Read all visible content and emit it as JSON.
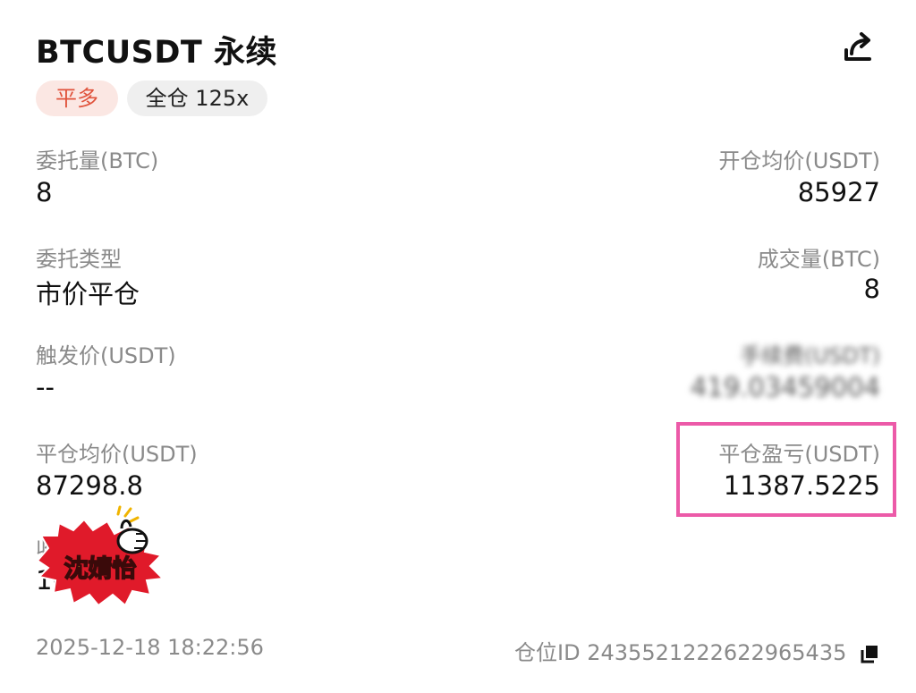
{
  "header": {
    "title": "BTCUSDT 永续",
    "tags": {
      "side": "平多",
      "margin": "全仓 125x"
    }
  },
  "fields": {
    "order_qty": {
      "label": "委托量(BTC)",
      "value": "8"
    },
    "open_avg": {
      "label": "开仓均价(USDT)",
      "value": "85927"
    },
    "order_type": {
      "label": "委托类型",
      "value": "市价平仓"
    },
    "filled_qty": {
      "label": "成交量(BTC)",
      "value": "8"
    },
    "trigger_price": {
      "label": "触发价(USDT)",
      "value": "--"
    },
    "fee": {
      "label": "手续费(USDT)",
      "value": "419.03459004"
    },
    "close_avg": {
      "label": "平仓均价(USDT)",
      "value": "87298.8"
    },
    "close_pnl": {
      "label": "平仓盈亏(USDT)",
      "value": "11387.5225"
    },
    "net_pnl": {
      "label": "收益率",
      "value": "10.6"
    }
  },
  "footer": {
    "timestamp": "2025-12-18 18:22:56",
    "position_id_label": "仓位ID",
    "position_id": "2435521222622965435"
  },
  "watermark": {
    "text": "沈婧怡"
  },
  "colors": {
    "long_tag_bg": "#fbe7e3",
    "long_tag_text": "#e0533c",
    "highlight_border": "#ec5aa8"
  }
}
